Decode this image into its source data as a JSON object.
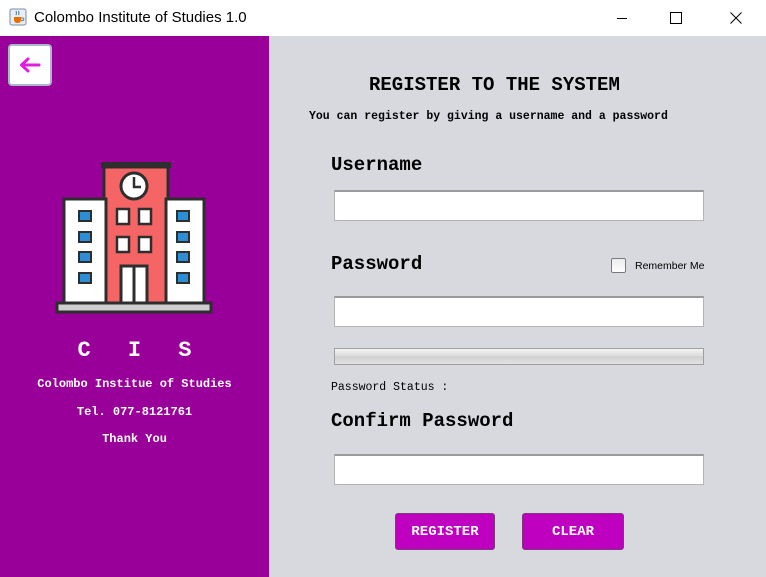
{
  "window": {
    "title": "Colombo Institute of Studies 1.0",
    "icons": {
      "app": "java-cup-icon",
      "minimize": "minimize-icon",
      "maximize": "maximize-icon",
      "close": "close-icon"
    }
  },
  "sidebar": {
    "back_icon": "arrow-left-icon",
    "logo_icon": "school-building-icon",
    "name": "C I S",
    "full_name": "Colombo Institue of Studies",
    "phone": "Tel. 077-8121761",
    "thanks": "Thank You",
    "color": "#990099"
  },
  "form": {
    "heading": "REGISTER TO THE SYSTEM",
    "subheading": "You can register by giving a username and a password",
    "username_label": "Username",
    "username_value": "",
    "password_label": "Password",
    "password_value": "",
    "remember_label": "Remember Me",
    "remember_checked": false,
    "password_strength": 0,
    "password_status_label": "Password Status :",
    "confirm_label": "Confirm Password",
    "confirm_value": "",
    "background": "#d8d9df"
  },
  "buttons": {
    "register": "REGISTER",
    "clear": "CLEAR",
    "color": "#c000c0"
  }
}
